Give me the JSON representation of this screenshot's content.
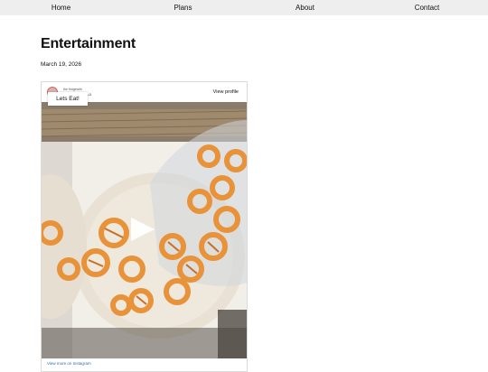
{
  "nav": {
    "items": [
      {
        "label": "Home"
      },
      {
        "label": "Plans"
      },
      {
        "label": "About"
      },
      {
        "label": "Contact"
      }
    ]
  },
  "page": {
    "title": "Entertainment",
    "date": "March 19, 2026"
  },
  "embed": {
    "account_name": "the fridgewith",
    "account_sub": "Lo",
    "view_profile_label": "View profile",
    "tooltip": "Lets Eat!",
    "view_more_label": "View more on Instagram",
    "play_icon": "play-icon",
    "colors": {
      "snack": "#e8923a",
      "plate": "#ece4d6",
      "border": "#dbdbdb"
    }
  }
}
